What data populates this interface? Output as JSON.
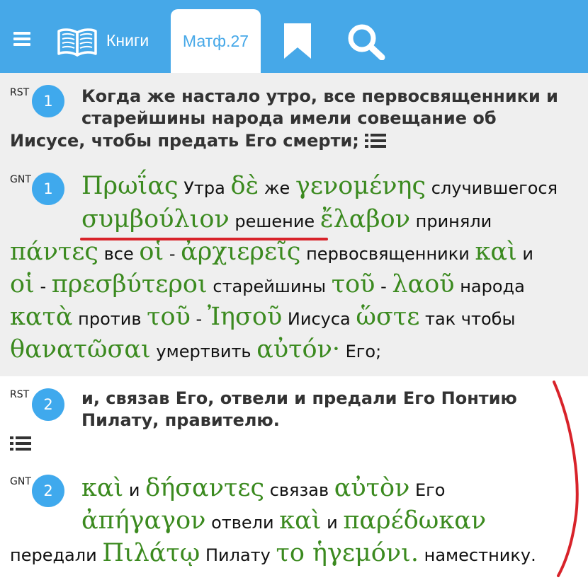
{
  "toolbar": {
    "books_label": "Книги",
    "active_tab_label": "Матф.27"
  },
  "verse1": {
    "rst_tag": "RST",
    "gnt_tag": "GNT",
    "number": "1",
    "rst_line1": "Когда же настало утро, все первосвященники и",
    "rst_line2": "старейшины народа имели совещание об",
    "rst_line3": "Иисусе, чтобы предать Его смерти;",
    "gnt": {
      "l1": [
        "Πρωΐας",
        "Утра",
        "δὲ",
        "же",
        "γενομένης",
        "случившегося"
      ],
      "l2": [
        "συμβούλιον",
        "решение",
        "ἔλαβον",
        "приняли"
      ],
      "l3": [
        "πάντες",
        "все",
        "οἱ",
        "-",
        "ἀρχιερεῖς",
        "первосвященники",
        "καὶ",
        "и"
      ],
      "l4": [
        "οἱ",
        "-",
        "πρεσβύτεροι",
        "старейшины",
        "τοῦ",
        "-",
        "λαοῦ",
        "народа"
      ],
      "l5": [
        "κατὰ",
        "против",
        "τοῦ",
        "-",
        "Ἰησοῦ",
        "Иисуса",
        "ὥστε",
        "так чтобы"
      ],
      "l6": [
        "θανατῶσαι",
        "умертвить",
        "αὐτόν·",
        "Его;"
      ]
    }
  },
  "verse2": {
    "rst_tag": "RST",
    "gnt_tag": "GNT",
    "number": "2",
    "rst_line1": "и, связав Его, отвели и предали Его Понтию",
    "rst_line2": "Пилату, правителю.",
    "gnt": {
      "l1": [
        "καὶ",
        "и",
        "δήσαντες",
        "связав",
        "αὐτὸν",
        "Его"
      ],
      "l2": [
        "ἀπήγαγον",
        "отвели",
        "καὶ",
        "и",
        "παρέδωκαν"
      ],
      "l3": [
        "передали",
        "Πιλάτῳ",
        "Пилату",
        "το ἡγεμόνι.",
        "наместнику."
      ]
    }
  },
  "colors": {
    "header_blue": "#46a8e8",
    "badge_blue": "#3fa9ed",
    "greek_green": "#3b8a1f",
    "annotation_red": "#d8232a"
  }
}
